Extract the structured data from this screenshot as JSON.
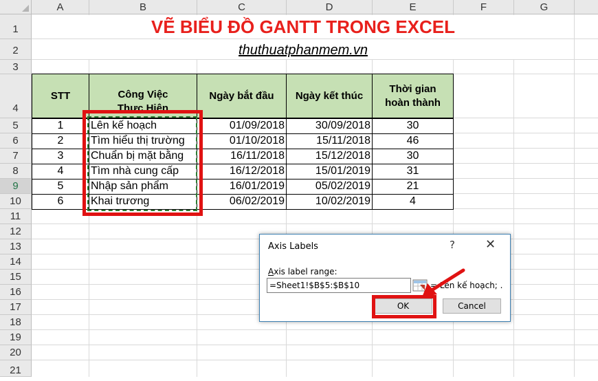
{
  "columns": [
    "A",
    "B",
    "C",
    "D",
    "E",
    "F",
    "G"
  ],
  "rows": [
    "1",
    "2",
    "3",
    "4",
    "5",
    "6",
    "7",
    "8",
    "9",
    "10",
    "11",
    "12",
    "13",
    "14",
    "15",
    "16",
    "17",
    "18",
    "19",
    "20",
    "21"
  ],
  "title": "VẼ BIỂU ĐỒ GANTT TRONG EXCEL",
  "subtitle": "thuthuatphanmem.vn",
  "table": {
    "headers": [
      "STT",
      "Công Việc Thực Hiện",
      "Ngày bắt đầu",
      "Ngày kết thúc",
      "Thời gian hoàn thành"
    ],
    "header_line1": "Công Việc",
    "header_line2": "Thực Hiện",
    "time_line1": "Thời gian",
    "time_line2": "hoàn thành",
    "rows": [
      {
        "stt": "1",
        "task": "Lên kế hoạch",
        "start": "01/09/2018",
        "end": "30/09/2018",
        "days": "30"
      },
      {
        "stt": "2",
        "task": "Tìm hiểu thị trường",
        "start": "01/10/2018",
        "end": "15/11/2018",
        "days": "46"
      },
      {
        "stt": "3",
        "task": "Chuẩn bị mặt bằng",
        "start": "16/11/2018",
        "end": "15/12/2018",
        "days": "30"
      },
      {
        "stt": "4",
        "task": "Tìm nhà cung cấp",
        "start": "16/12/2018",
        "end": "15/01/2019",
        "days": "31"
      },
      {
        "stt": "5",
        "task": "Nhập sản phẩm",
        "start": "16/01/2019",
        "end": "05/02/2019",
        "days": "21"
      },
      {
        "stt": "6",
        "task": "Khai trương",
        "start": "06/02/2019",
        "end": "10/02/2019",
        "days": "4"
      }
    ]
  },
  "dialog": {
    "title": "Axis Labels",
    "help": "?",
    "close": "✕",
    "field_label": "Axis label range:",
    "range_value": "=Sheet1!$B$5:$B$10",
    "preview": "= Lên kế hoạch; .",
    "ok": "OK",
    "cancel": "Cancel"
  },
  "colors": {
    "title_red": "#e8201c",
    "header_green": "#c6e0b4",
    "highlight_red": "#e01212",
    "dash_green": "#2e7d32"
  }
}
